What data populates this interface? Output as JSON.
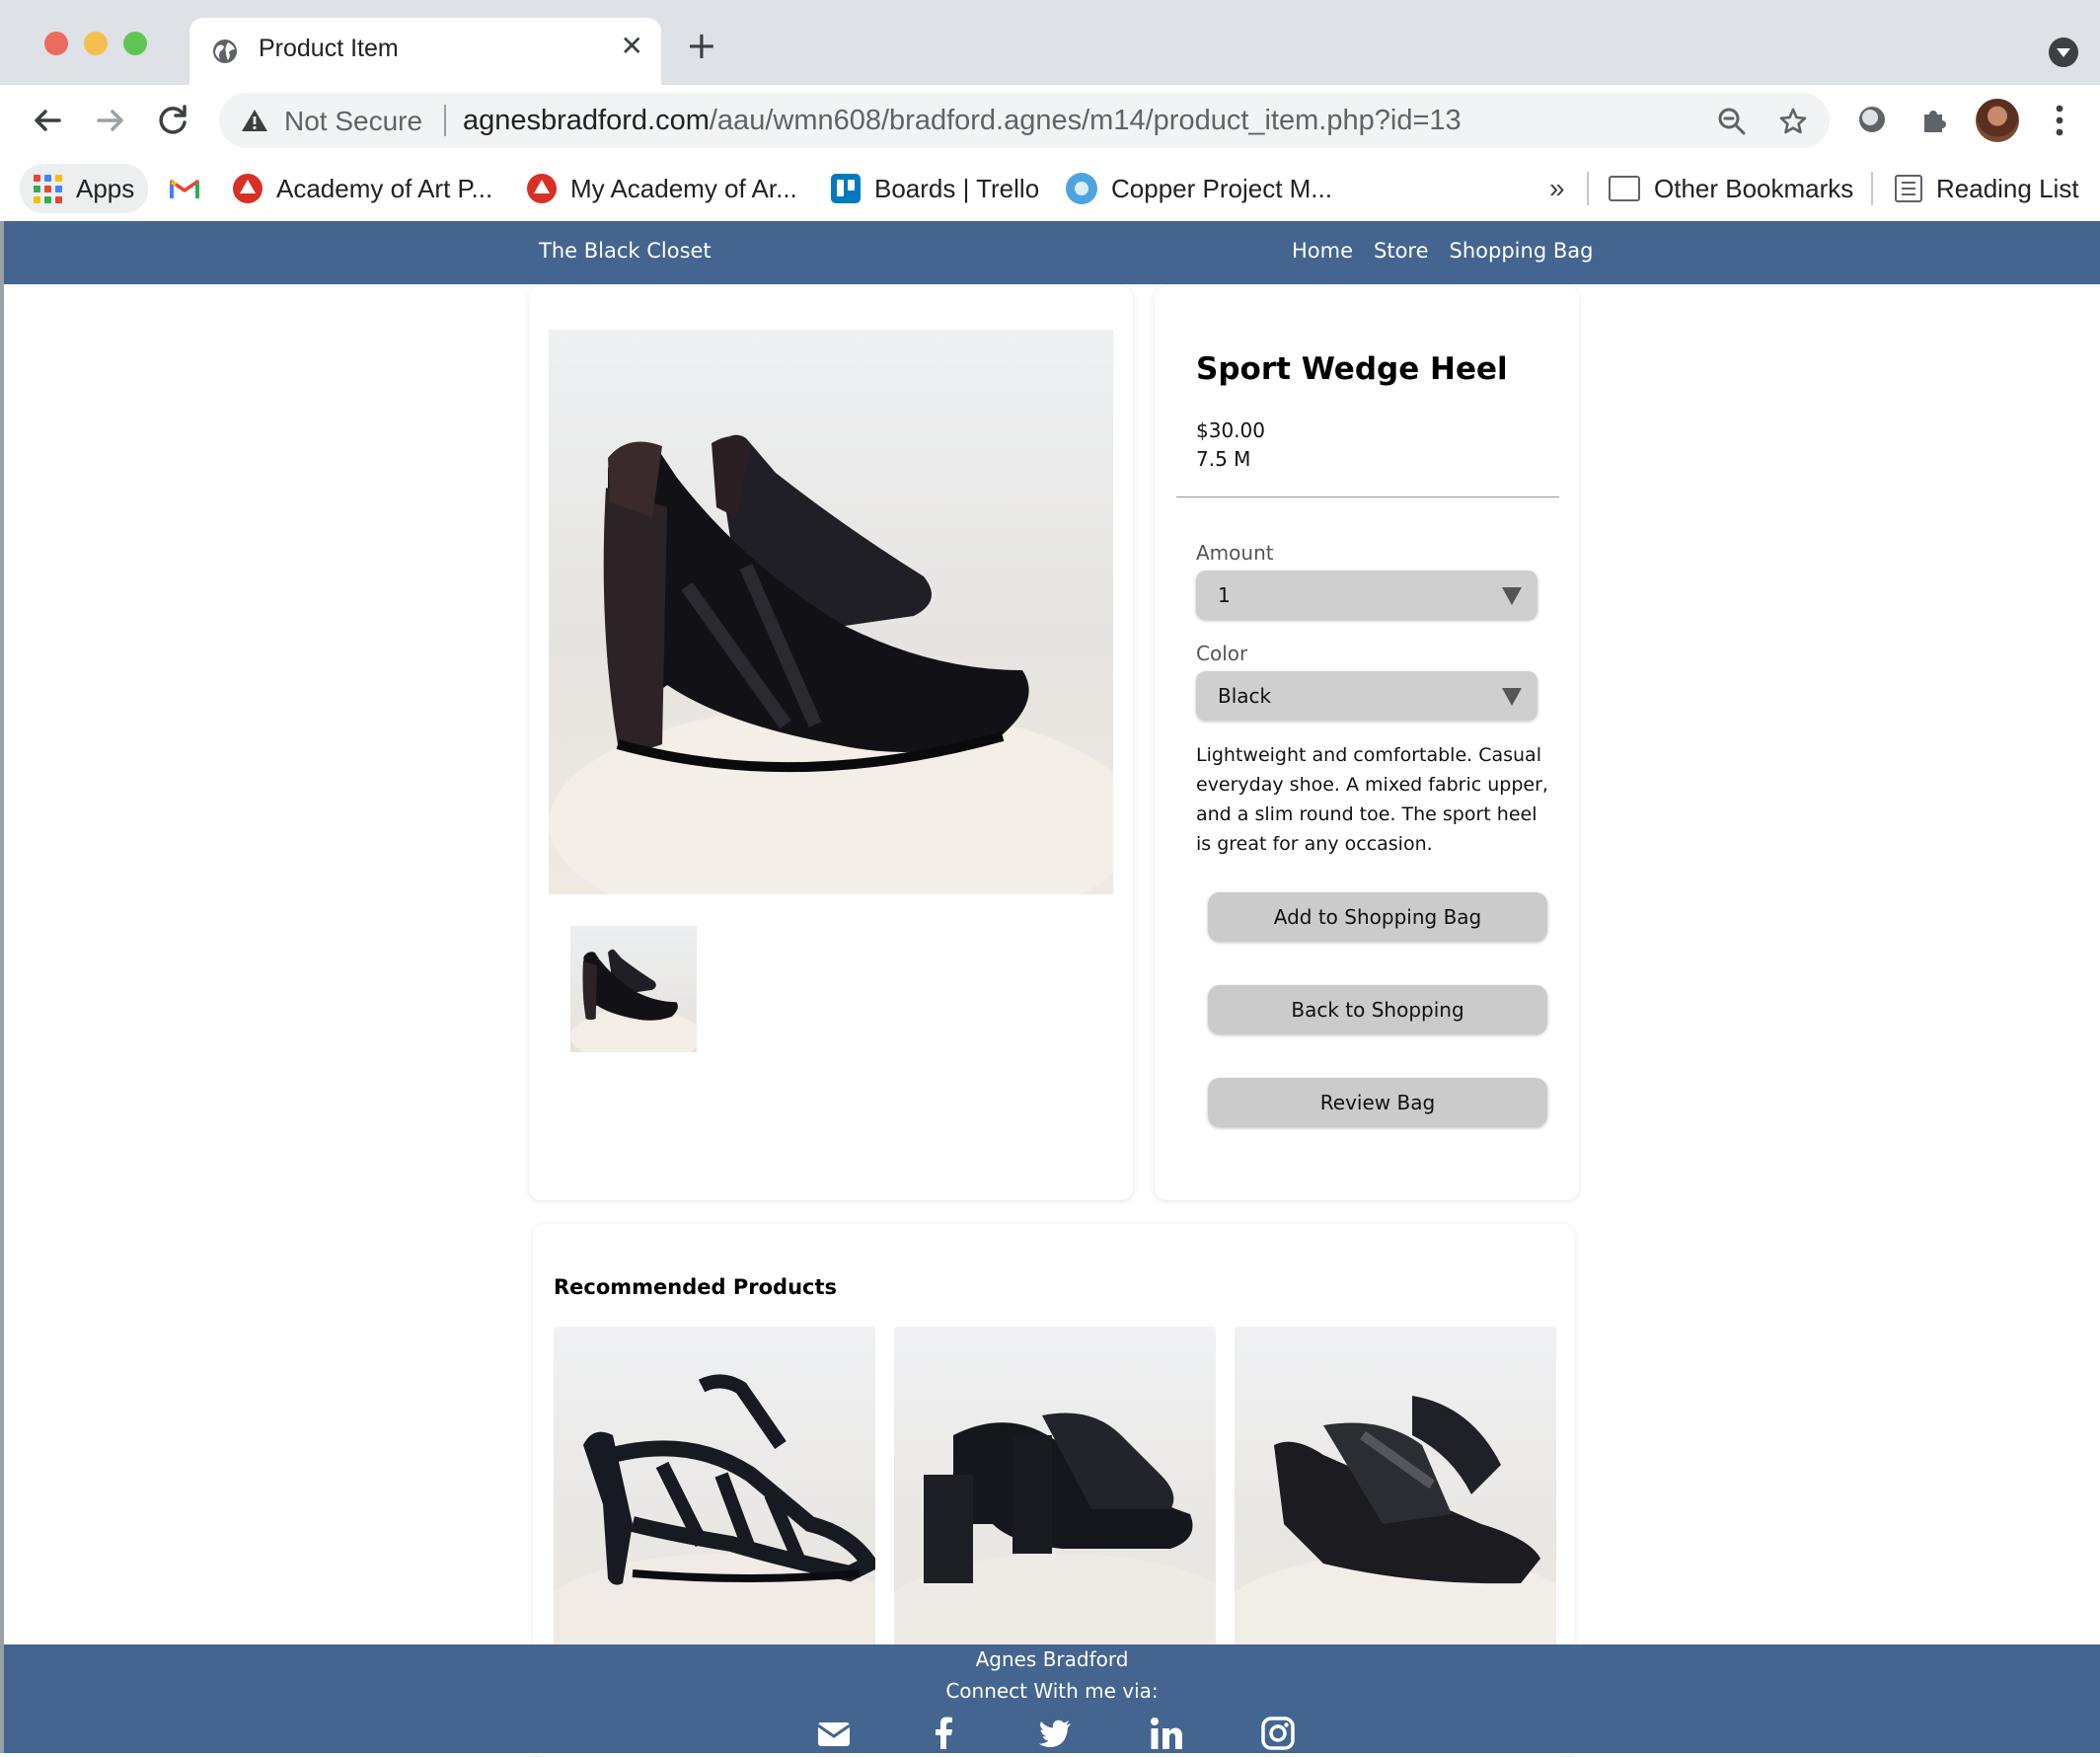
{
  "browser": {
    "tab_title": "Product Item",
    "tab_close": "✕",
    "new_tab": "+",
    "security_label": "Not Secure",
    "url_host": "agnesbradford.com",
    "url_path": "/aau/wmn608/bradford.agnes/m14/product_item.php?id=13"
  },
  "bookmarks": {
    "items": [
      {
        "label": "Apps",
        "icon": "apps-grid-icon"
      },
      {
        "label": "",
        "icon": "gmail-icon"
      },
      {
        "label": "Academy of Art P...",
        "icon": "academy-of-art-icon"
      },
      {
        "label": "My Academy of Ar...",
        "icon": "academy-of-art-icon"
      },
      {
        "label": "Boards | Trello",
        "icon": "trello-icon"
      },
      {
        "label": "Copper Project M...",
        "icon": "copper-icon"
      }
    ],
    "overflow": "»",
    "other": "Other Bookmarks",
    "reading_list": "Reading List"
  },
  "site": {
    "brand": "The Black Closet",
    "nav": [
      "Home",
      "Store",
      "Shopping Bag"
    ]
  },
  "product": {
    "name": "Sport Wedge Heel",
    "price": "$30.00",
    "size": "7.5 M",
    "amount_label": "Amount",
    "amount_value": "1",
    "color_label": "Color",
    "color_value": "Black",
    "description": "Lightweight and comfortable. Casual everyday shoe. A mixed fabric upper, and a slim round toe. The sport heel is great for any occasion.",
    "buttons": [
      "Add to Shopping Bag",
      "Back to Shopping",
      "Review Bag"
    ]
  },
  "recommended": {
    "title": "Recommended Products",
    "items": [
      "strappy-heel-sandal",
      "black-heeled-mule",
      "platform-wedge-sandal"
    ]
  },
  "footer": {
    "name": "Agnes Bradford",
    "connect": "Connect With me via:",
    "social": [
      "email-icon",
      "facebook-icon",
      "twitter-icon",
      "linkedin-icon",
      "instagram-icon"
    ]
  },
  "colors": {
    "nav_bar": "#43658f",
    "button": "#cbcbcb",
    "chrome": "#dee1e6"
  }
}
